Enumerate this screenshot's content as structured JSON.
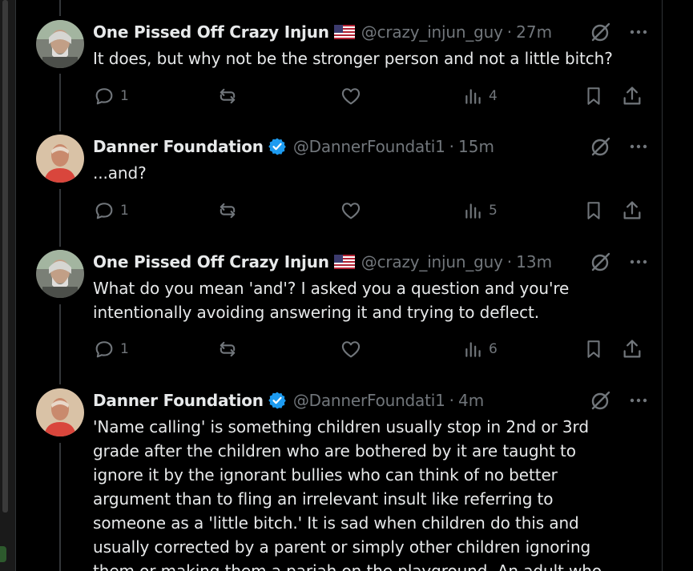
{
  "colors": {
    "background": "#000000",
    "text_primary": "#e7e9ea",
    "text_secondary": "#71767b",
    "verified_blue": "#1d9bf0",
    "thread_line": "#333639"
  },
  "tweets": [
    {
      "author_name": "One Pissed Off Crazy Injun",
      "author_flag": "us-flag-icon",
      "verified": false,
      "handle": "@crazy_injun_guy",
      "separator": "·",
      "time": "27m",
      "text": "It does, but why not be the stronger person and not a little bitch?",
      "replies": "1",
      "reposts": "",
      "likes": "",
      "views": "4"
    },
    {
      "author_name": "Danner Foundation",
      "verified": true,
      "handle": "@DannerFoundati1",
      "separator": "·",
      "time": "15m",
      "text": "...and?",
      "replies": "1",
      "reposts": "",
      "likes": "",
      "views": "5"
    },
    {
      "author_name": "One Pissed Off Crazy Injun",
      "author_flag": "us-flag-icon",
      "verified": false,
      "handle": "@crazy_injun_guy",
      "separator": "·",
      "time": "13m",
      "text": "What do you mean 'and'? I asked you a question and you're\nintentionally avoiding answering it and trying to deflect.",
      "replies": "1",
      "reposts": "",
      "likes": "",
      "views": "6"
    },
    {
      "author_name": "Danner Foundation",
      "verified": true,
      "handle": "@DannerFoundati1",
      "separator": "·",
      "time": "4m",
      "text": "'Name calling' is something children usually stop in 2nd or 3rd\ngrade after the children who are bothered by it are taught to\nignore it by the ignorant bullies who can think of no better\nargument than to fling an irrelevant insult like referring to\nsomeone as a 'little bitch.' It is sad when children do this and\nusually corrected by a parent or simply other children ignoring\nthem or making them a pariah on the playground. An adult who"
    }
  ]
}
